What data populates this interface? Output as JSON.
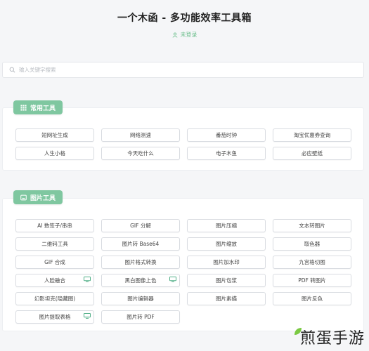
{
  "header": {
    "title": "一个木函 - 多功能效率工具箱",
    "login_text": "未登录"
  },
  "search": {
    "placeholder": "输入关键字搜索",
    "value": ""
  },
  "sections": [
    {
      "title": "常用工具",
      "icon": "grid-icon",
      "items": [
        {
          "label": "短网址生成"
        },
        {
          "label": "网络测速"
        },
        {
          "label": "番茄时钟"
        },
        {
          "label": "淘宝优惠券查询"
        },
        {
          "label": "人生小格"
        },
        {
          "label": "今天吃什么"
        },
        {
          "label": "电子木鱼"
        },
        {
          "label": "必应壁纸"
        }
      ]
    },
    {
      "title": "图片工具",
      "icon": "image-icon",
      "items": [
        {
          "label": "AI 数签子/串串"
        },
        {
          "label": "GIF 分解"
        },
        {
          "label": "图片压缩"
        },
        {
          "label": "文本转图片"
        },
        {
          "label": "二维码工具"
        },
        {
          "label": "图片转 Base64"
        },
        {
          "label": "图片缩放"
        },
        {
          "label": "取色器"
        },
        {
          "label": "GIF 合成"
        },
        {
          "label": "图片格式转换"
        },
        {
          "label": "图片加水印"
        },
        {
          "label": "九宫格切图"
        },
        {
          "label": "人脸融合",
          "desktop": true
        },
        {
          "label": "黑白图像上色",
          "desktop": true
        },
        {
          "label": "图片包浆"
        },
        {
          "label": "PDF 转图片"
        },
        {
          "label": "幻影坦克(隐藏图)"
        },
        {
          "label": "图片编辑器"
        },
        {
          "label": "图片素描"
        },
        {
          "label": "图片反色"
        },
        {
          "label": "图片提取表格",
          "desktop": true
        },
        {
          "label": "图片转 PDF"
        }
      ]
    }
  ],
  "watermark": {
    "text": "煎蛋手游"
  },
  "colors": {
    "accent": "#7fc7a0",
    "login": "#6cbf8c",
    "desktop_tag": "#4fae86"
  }
}
